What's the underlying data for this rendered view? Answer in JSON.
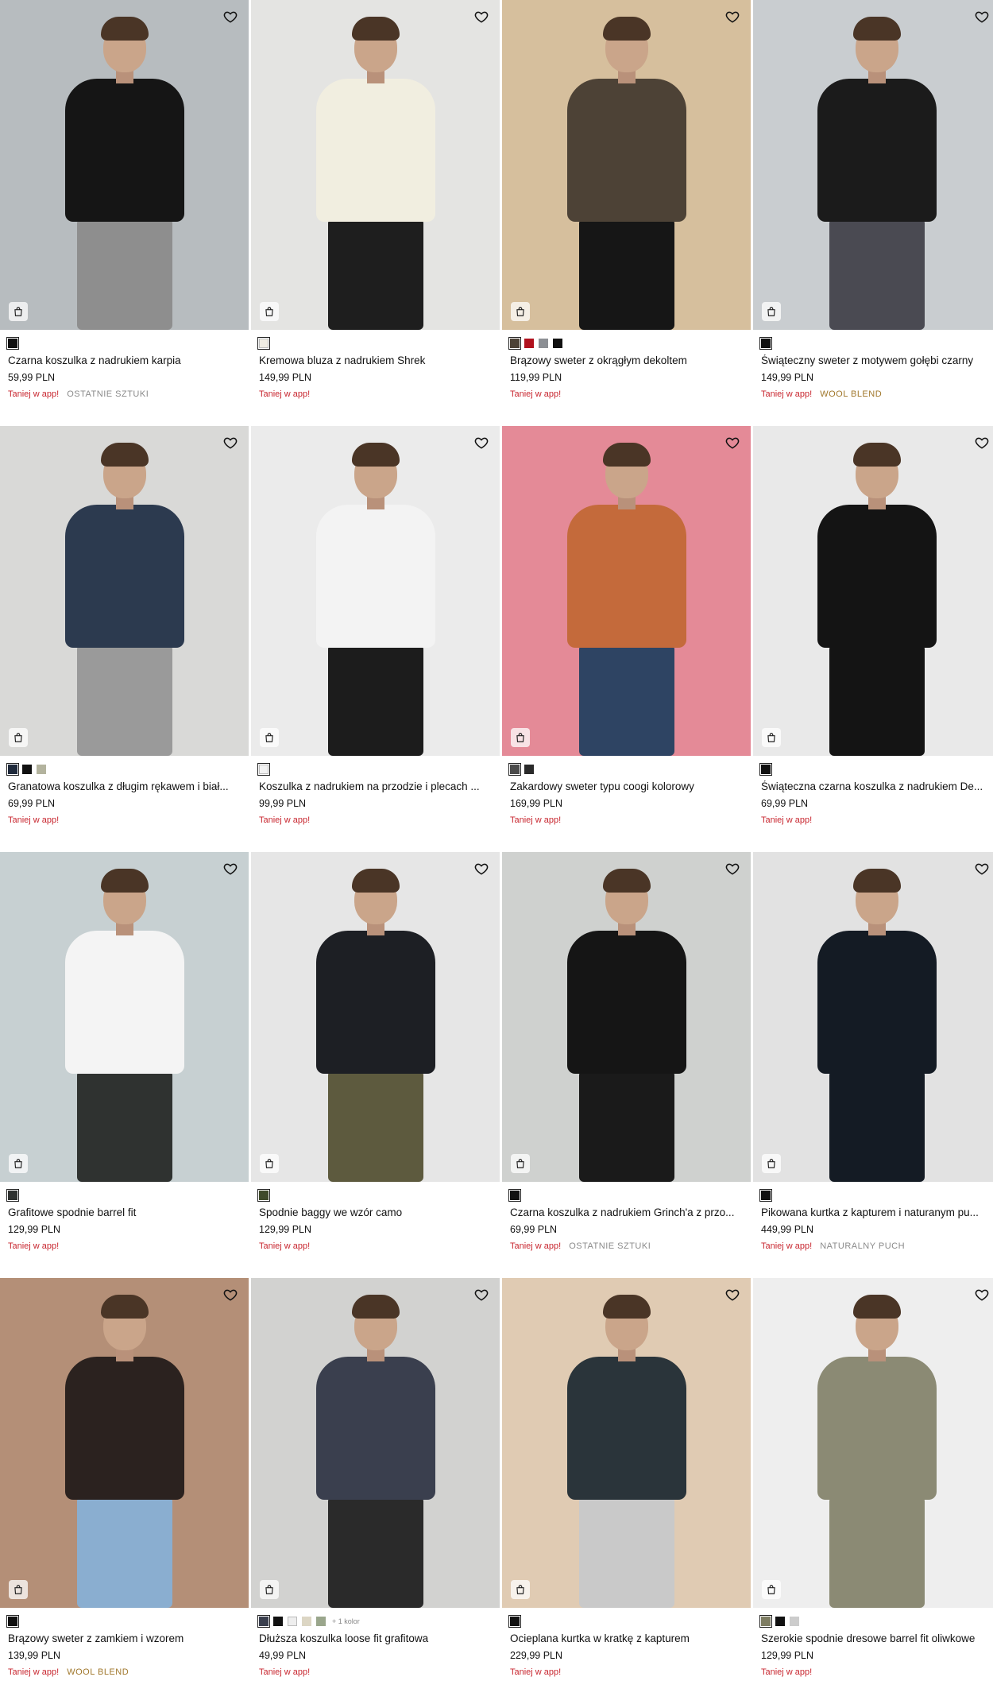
{
  "products": [
    {
      "name": "Czarna koszulka z nadrukiem karpia",
      "price": "59,99 PLN",
      "promo": "Taniej w app!",
      "tag": "OSTATNIE SZTUKI",
      "tag_style": "grey",
      "bg": "#b7bcbf",
      "shirt": "#151515",
      "pants": "#8e8e8e",
      "swatches": [
        "#111111"
      ],
      "more": ""
    },
    {
      "name": "Kremowa bluza z nadrukiem Shrek",
      "price": "149,99 PLN",
      "promo": "Taniej w app!",
      "tag": "",
      "tag_style": "grey",
      "bg": "#e4e4e2",
      "shirt": "#f1eee0",
      "pants": "#1e1e1e",
      "swatches": [
        "#f0ede4"
      ],
      "more": ""
    },
    {
      "name": "Brązowy sweter z okrągłym dekoltem",
      "price": "119,99 PLN",
      "promo": "Taniej w app!",
      "tag": "",
      "tag_style": "grey",
      "bg": "#d6bf9d",
      "shirt": "#4d4236",
      "pants": "#161616",
      "swatches": [
        "#4d4236",
        "#b1121e",
        "#8c8f94",
        "#111111"
      ],
      "more": ""
    },
    {
      "name": "Świąteczny sweter z motywem gołębi czarny",
      "price": "149,99 PLN",
      "promo": "Taniej w app!",
      "tag": "WOOL BLEND",
      "tag_style": "gold",
      "bg": "#c9cdd0",
      "shirt": "#1b1b1b",
      "pants": "#4a4a52",
      "swatches": [
        "#111111"
      ],
      "more": ""
    },
    {
      "name": "Granatowa koszulka z długim rękawem i biał...",
      "price": "69,99 PLN",
      "promo": "Taniej w app!",
      "tag": "",
      "tag_style": "grey",
      "bg": "#d9d9d7",
      "shirt": "#2c3a4f",
      "pants": "#9a9a9a",
      "swatches": [
        "#1f2a3c",
        "#111111",
        "#b3b39e"
      ],
      "more": ""
    },
    {
      "name": "Koszulka z nadrukiem na przodzie i plecach ...",
      "price": "99,99 PLN",
      "promo": "Taniej w app!",
      "tag": "",
      "tag_style": "grey",
      "bg": "#ebebeb",
      "shirt": "#f3f3f3",
      "pants": "#1c1c1c",
      "swatches": [
        "#f2f2f2"
      ],
      "more": ""
    },
    {
      "name": "Zakardowy sweter typu coogi kolorowy",
      "price": "169,99 PLN",
      "promo": "Taniej w app!",
      "tag": "",
      "tag_style": "grey",
      "bg": "#e48a97",
      "shirt": "#c46a3b",
      "pants": "#2e4463",
      "swatches": [
        "#4b4b4b",
        "#2a2a2a"
      ],
      "more": ""
    },
    {
      "name": "Świąteczna czarna koszulka z nadrukiem De...",
      "price": "69,99 PLN",
      "promo": "Taniej w app!",
      "tag": "",
      "tag_style": "grey",
      "bg": "#e9e9e9",
      "shirt": "#141414",
      "pants": "#141414",
      "swatches": [
        "#111111"
      ],
      "more": ""
    },
    {
      "name": "Grafitowe spodnie barrel fit",
      "price": "129,99 PLN",
      "promo": "Taniej w app!",
      "tag": "",
      "tag_style": "grey",
      "bg": "#c7d0d2",
      "shirt": "#f4f4f4",
      "pants": "#2f3230",
      "swatches": [
        "#2f3230"
      ],
      "more": ""
    },
    {
      "name": "Spodnie baggy we wzór camo",
      "price": "129,99 PLN",
      "promo": "Taniej w app!",
      "tag": "",
      "tag_style": "grey",
      "bg": "#e6e6e6",
      "shirt": "#1d1f24",
      "pants": "#5d5a3e",
      "swatches": [
        "#3f4a2a"
      ],
      "more": ""
    },
    {
      "name": "Czarna koszulka z nadrukiem Grinch'a z przo...",
      "price": "69,99 PLN",
      "promo": "Taniej w app!",
      "tag": "OSTATNIE SZTUKI",
      "tag_style": "grey",
      "bg": "#cfd1cf",
      "shirt": "#151515",
      "pants": "#1a1a1a",
      "swatches": [
        "#111111"
      ],
      "more": ""
    },
    {
      "name": "Pikowana kurtka z kapturem i naturanym pu...",
      "price": "449,99 PLN",
      "promo": "Taniej w app!",
      "tag": "NATURALNY PUCH",
      "tag_style": "grey",
      "bg": "#e2e2e2",
      "shirt": "#141b24",
      "pants": "#141b24",
      "swatches": [
        "#111111"
      ],
      "more": ""
    },
    {
      "name": "Brązowy sweter z zamkiem i wzorem",
      "price": "139,99 PLN",
      "promo": "Taniej w app!",
      "tag": "WOOL BLEND",
      "tag_style": "gold",
      "bg": "#b48f77",
      "shirt": "#2b221f",
      "pants": "#8aaed0",
      "swatches": [
        "#111111"
      ],
      "more": ""
    },
    {
      "name": "Dłuższa koszulka loose fit grafitowa",
      "price": "49,99 PLN",
      "promo": "Taniej w app!",
      "tag": "",
      "tag_style": "grey",
      "bg": "#d2d2d0",
      "shirt": "#3a3f4e",
      "pants": "#2a2a2a",
      "swatches": [
        "#3a3f4e",
        "#111111",
        "#eeeeee",
        "#dcd6c4",
        "#9aa68c"
      ],
      "more": "+ 1 kolor"
    },
    {
      "name": "Ocieplana kurtka w kratkę z kapturem",
      "price": "229,99 PLN",
      "promo": "Taniej w app!",
      "tag": "",
      "tag_style": "grey",
      "bg": "#e0cbb3",
      "shirt": "#2a343a",
      "pants": "#c9c9c9",
      "swatches": [
        "#111111"
      ],
      "more": ""
    },
    {
      "name": "Szerokie spodnie dresowe barrel fit oliwkowe",
      "price": "129,99 PLN",
      "promo": "Taniej w app!",
      "tag": "",
      "tag_style": "grey",
      "bg": "#eeeeee",
      "shirt": "#8b8a74",
      "pants": "#8b8a74",
      "swatches": [
        "#7e7d63",
        "#111111",
        "#cccccc"
      ],
      "more": ""
    }
  ],
  "icons": {
    "favorite": "heart-icon",
    "cart": "shopping-bag-icon"
  }
}
